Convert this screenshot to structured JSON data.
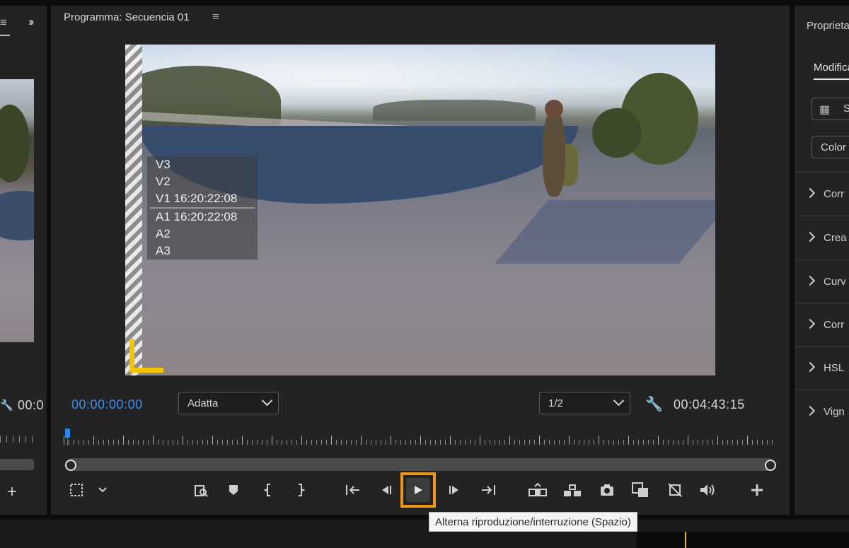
{
  "program_panel": {
    "title": "Programma: Secuencia 01",
    "current_time": "00:00:00:00",
    "fit_dropdown": "Adatta",
    "resolution_dropdown": "1/2",
    "duration": "00:04:43:15",
    "track_overlay": [
      "V3",
      "V2",
      "V1 16:20:22:08",
      "A1 16:20:22:08",
      "A2",
      "A3"
    ],
    "tooltip": "Alterna riproduzione/interruzione (Spazio)",
    "highlight_color": "#f0961e",
    "timecode_color": "#3a8cf0"
  },
  "source_panel": {
    "timecode_partial": "00:0"
  },
  "properties_panel": {
    "title": "Proprieta",
    "tab": "Modifica",
    "button1_label": "S",
    "button2_label": "Color",
    "sections": [
      "Corr",
      "Crea",
      "Curv",
      "Corr",
      "HSL",
      "Vign"
    ]
  },
  "controls": [
    "safe-margins-icon",
    "settings-chevron-icon",
    "export-frame-preview-icon",
    "add-marker-icon",
    "mark-in-icon",
    "mark-out-icon",
    "go-to-in-icon",
    "step-back-icon",
    "play-icon",
    "step-forward-icon",
    "go-to-out-icon",
    "lift-icon",
    "extract-icon",
    "export-frame-icon",
    "comparison-view-icon",
    "proxy-toggle-icon",
    "audio-icon",
    "add-button-icon"
  ]
}
